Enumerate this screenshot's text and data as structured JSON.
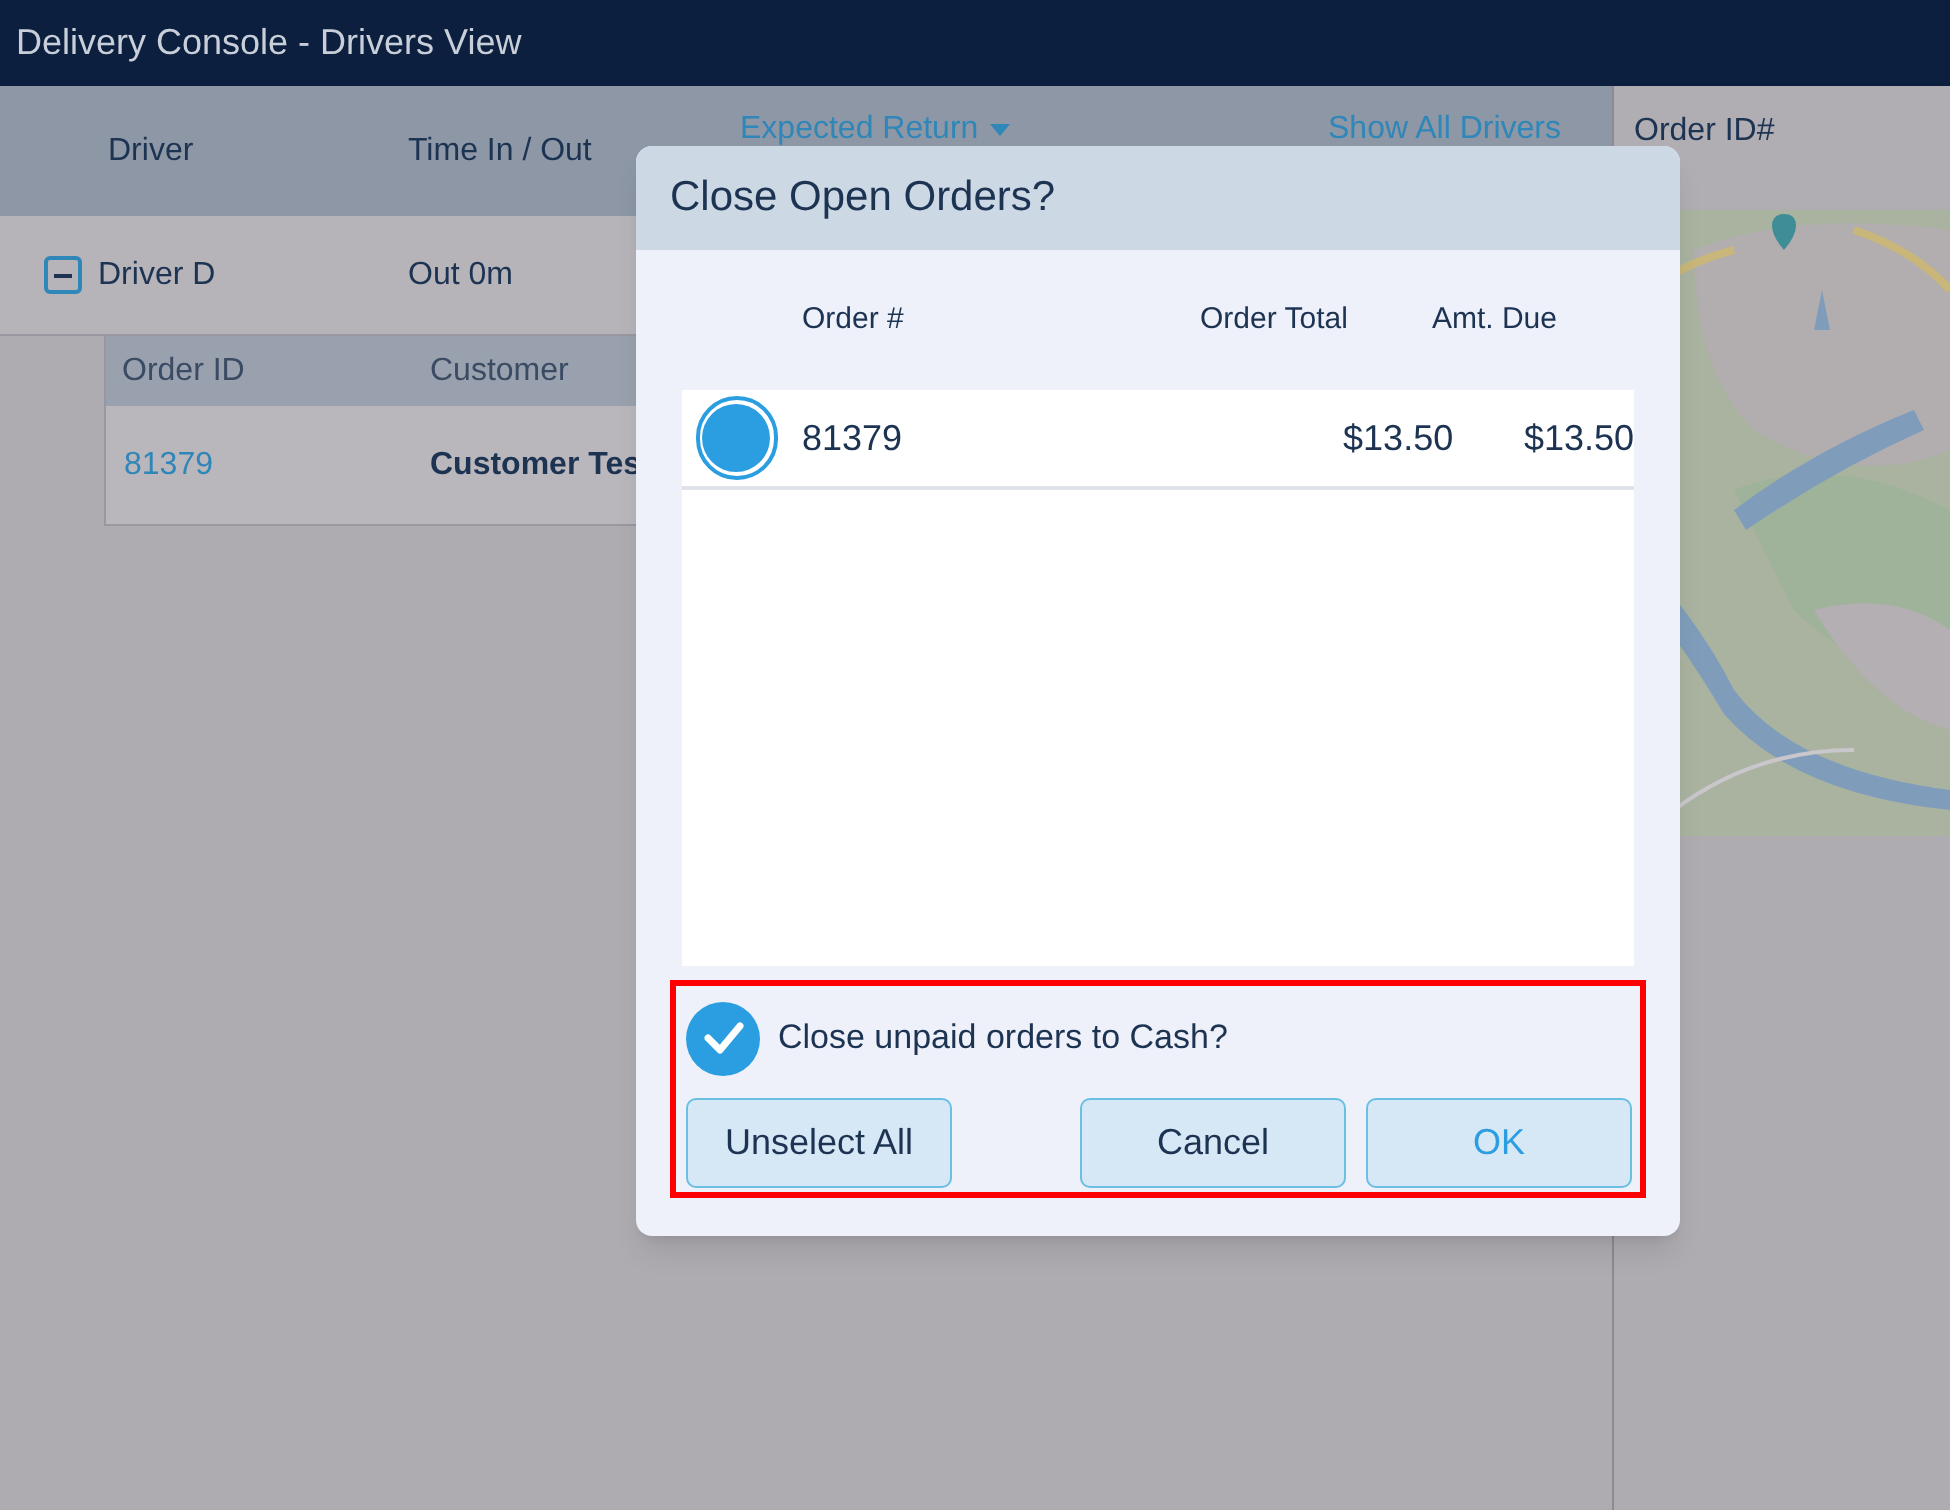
{
  "window": {
    "title": "Delivery Console - Drivers View"
  },
  "drivers_table": {
    "columns": [
      "Driver",
      "Time In / Out",
      "Expected Return"
    ],
    "show_all_link": "Show All Drivers",
    "rows": [
      {
        "driver": "Driver D",
        "time": "Out 0m",
        "expanded": true,
        "orders": {
          "columns": [
            "Order ID",
            "Customer"
          ],
          "rows": [
            {
              "order_id": "81379",
              "customer": "Customer Tes"
            }
          ]
        }
      }
    ]
  },
  "side_panel": {
    "header": "Order ID#"
  },
  "dialog": {
    "title": "Close Open Orders?",
    "columns": [
      "Order #",
      "Order Total",
      "Amt. Due"
    ],
    "rows": [
      {
        "order": "81379",
        "total": "$13.50",
        "due": "$13.50",
        "selected": true
      }
    ],
    "close_to_cash": {
      "label": "Close unpaid orders to Cash?",
      "checked": true
    },
    "buttons": [
      {
        "label": "Unselect All",
        "kind": "secondary"
      },
      {
        "label": "Cancel",
        "kind": "secondary"
      },
      {
        "label": "OK",
        "kind": "primary"
      }
    ]
  }
}
